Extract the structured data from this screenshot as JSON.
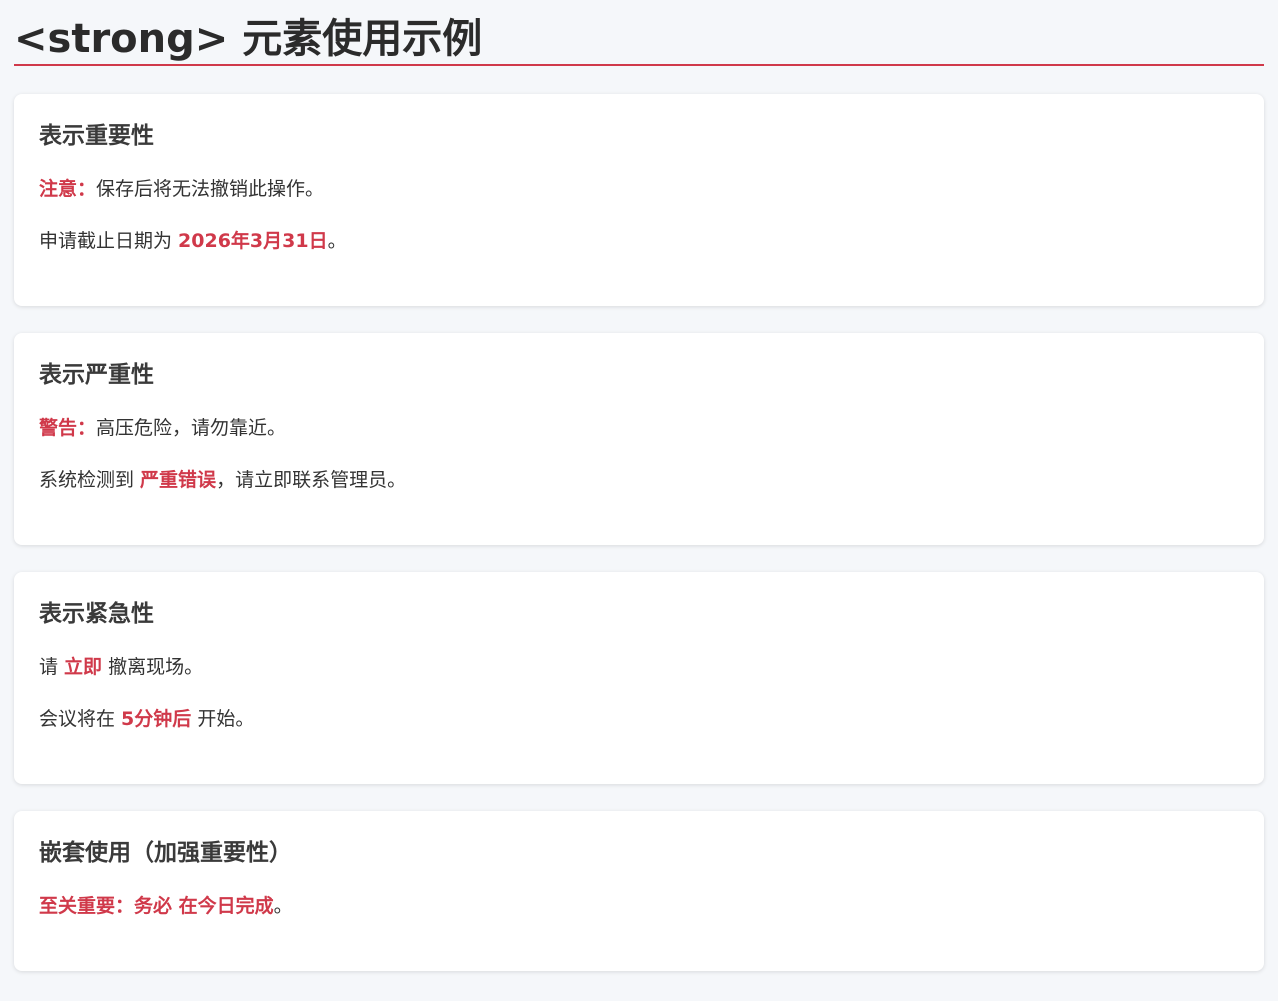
{
  "page_title": "<strong> 元素使用示例",
  "accent_color": "#d0394a",
  "sections": [
    {
      "heading": "表示重要性",
      "p1": {
        "strong": "注意：",
        "text": "保存后将无法撤销此操作。"
      },
      "p2": {
        "before": "申请截止日期为 ",
        "strong": "2026年3月31日",
        "after": "。"
      }
    },
    {
      "heading": "表示严重性",
      "p1": {
        "strong": "警告：",
        "text": "高压危险，请勿靠近。"
      },
      "p2": {
        "before": "系统检测到 ",
        "strong": "严重错误",
        "after": "，请立即联系管理员。"
      }
    },
    {
      "heading": "表示紧急性",
      "p1": {
        "before": "请 ",
        "strong": "立即",
        "after": " 撤离现场。"
      },
      "p2": {
        "before": "会议将在 ",
        "strong": "5分钟后",
        "after": " 开始。"
      }
    },
    {
      "heading": "嵌套使用（加强重要性）",
      "p1": {
        "strong_outer": "至关重要：务必 ",
        "strong_inner": "在今日完成",
        "after": "。"
      }
    }
  ]
}
